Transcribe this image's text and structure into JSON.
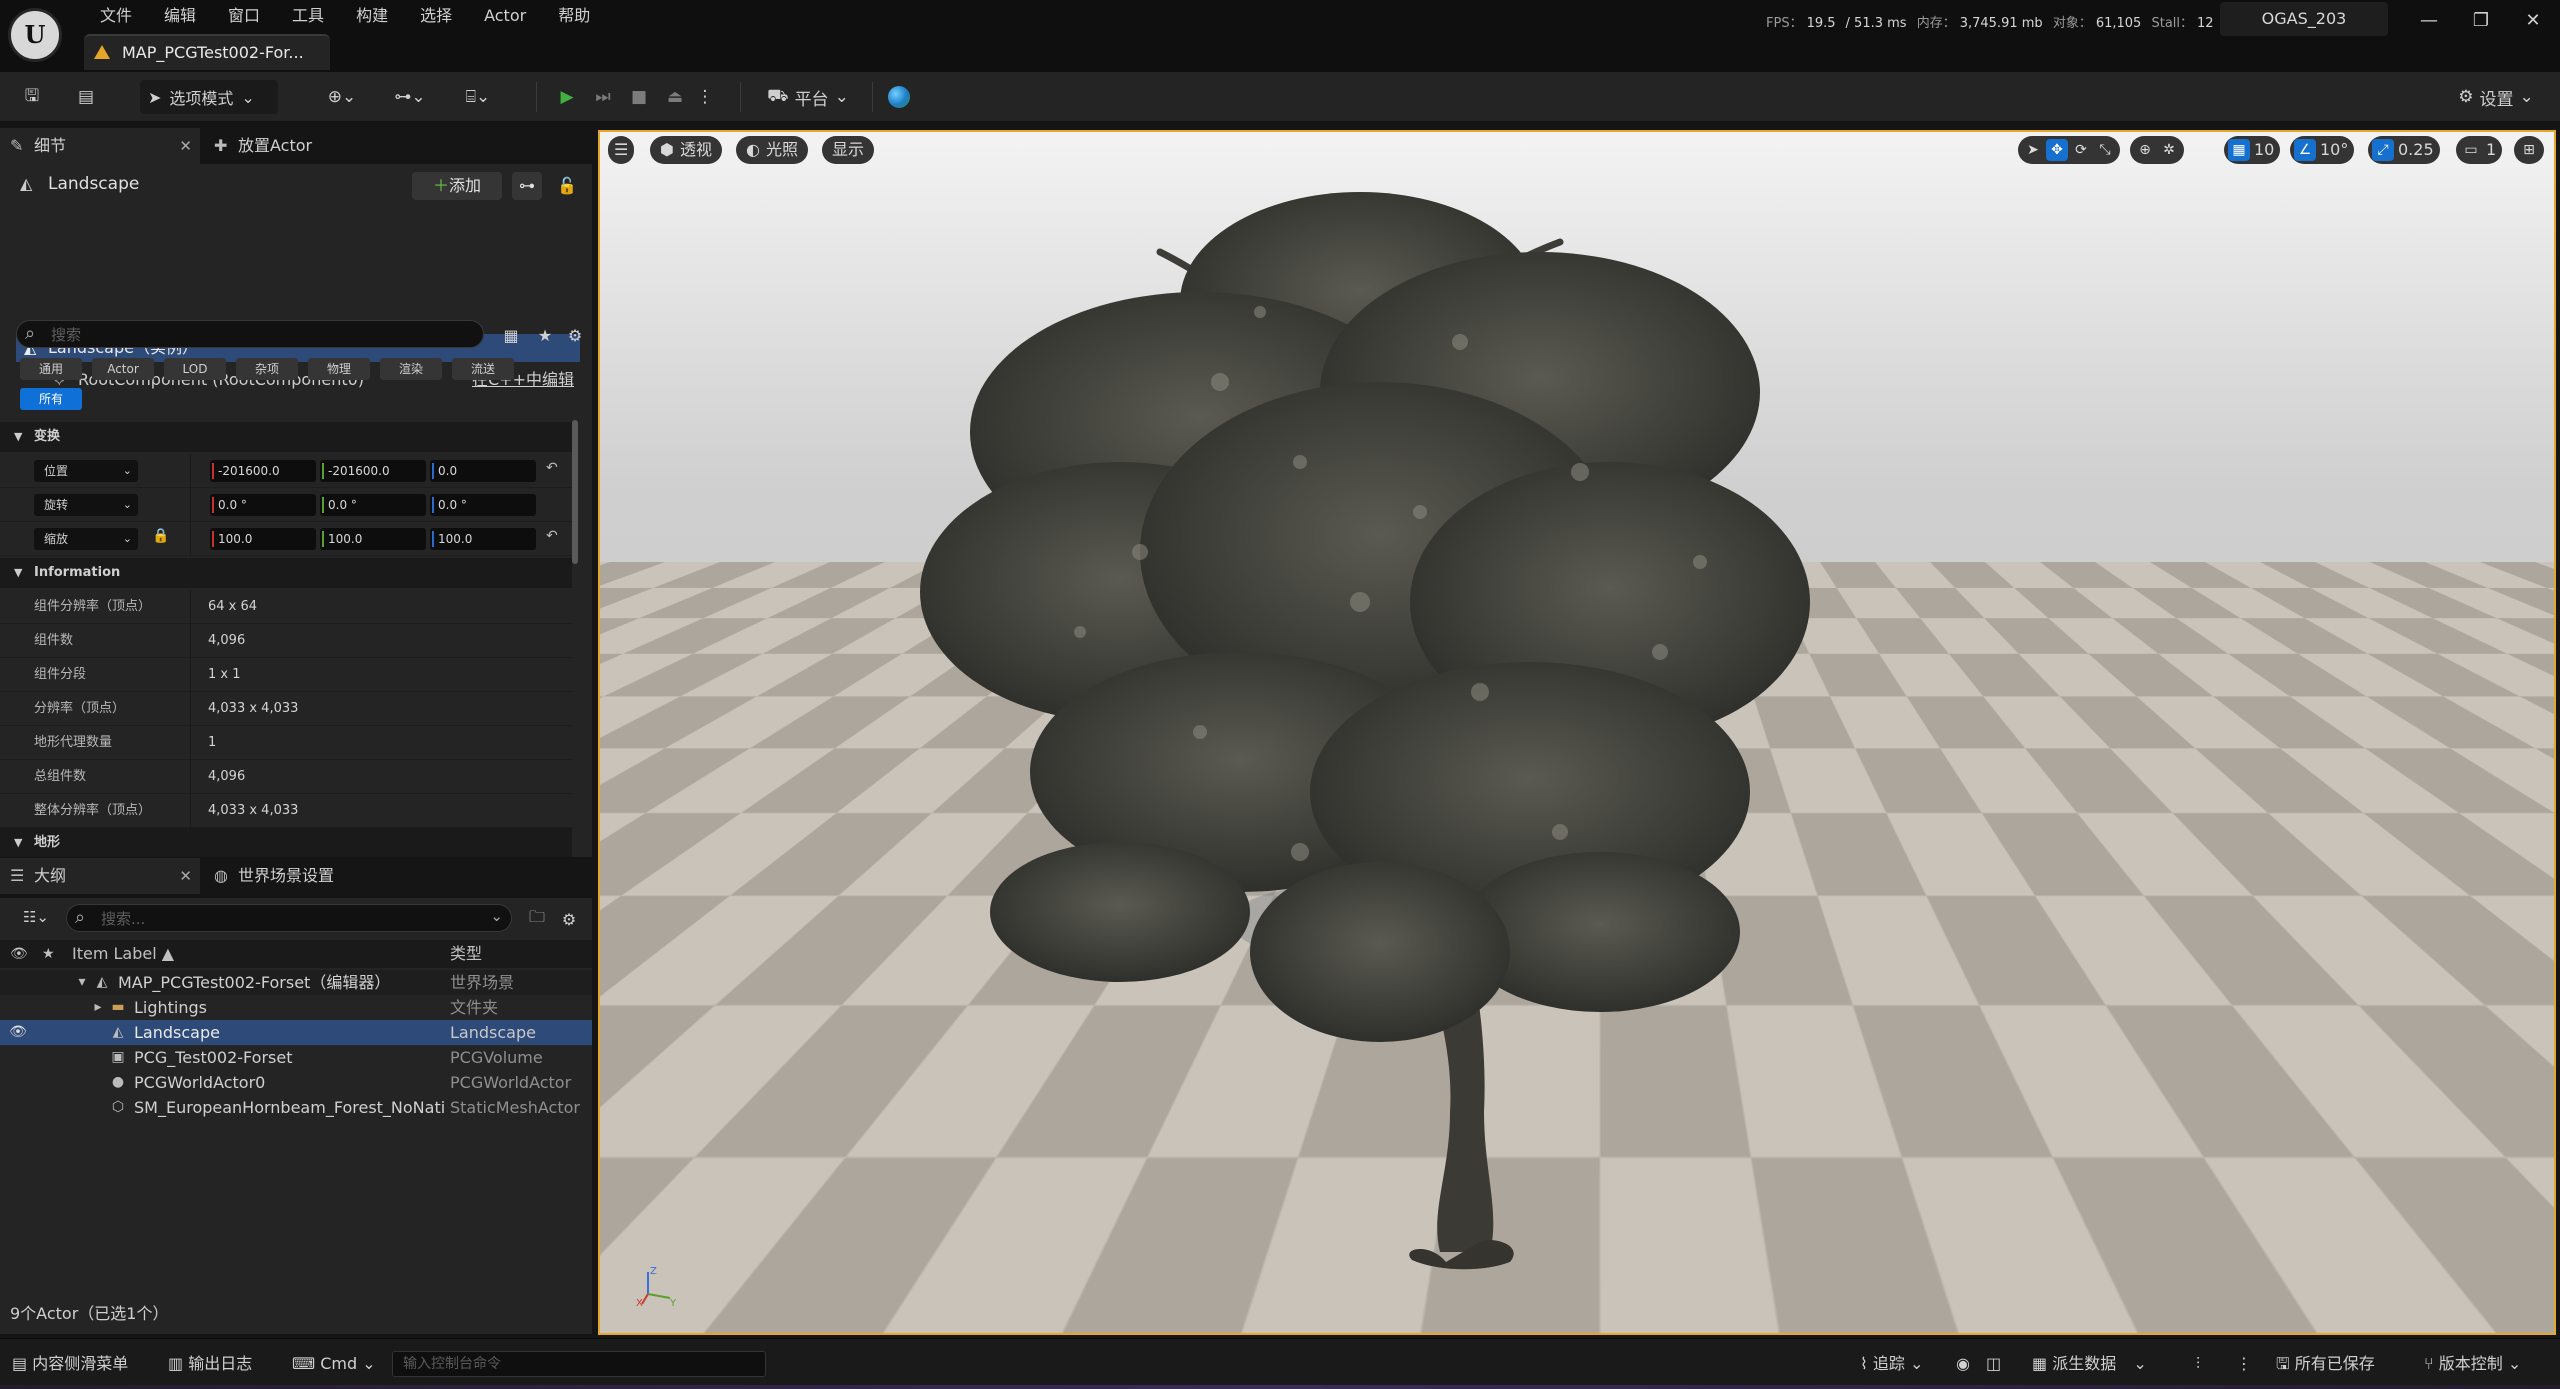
{
  "app": {
    "menu": [
      "文件",
      "编辑",
      "窗口",
      "工具",
      "构建",
      "选择",
      "Actor",
      "帮助"
    ],
    "doc_tab": "MAP_PCGTest002-For...",
    "stats": {
      "fps_label": "FPS：",
      "fps": "19.5",
      "ms": "/ 51.3 ms",
      "mem_label": "内存：",
      "mem": "3,745.91 mb",
      "obj_label": "对象：",
      "obj": "61,105",
      "stall_label": "Stall：",
      "stall": "12"
    },
    "project": "OGAS_203",
    "window_controls": [
      "—",
      "❐",
      "✕"
    ]
  },
  "toolbar": {
    "mode_select": "选项模式",
    "platform": "平台",
    "settings": "设置"
  },
  "details": {
    "tab_details": "细节",
    "tab_place": "放置Actor",
    "actor_name": "Landscape",
    "add_button": "添加",
    "component_root": "Landscape（实例）",
    "component_child": "RootComponent (RootComponent0)",
    "edit_cpp": "在C++中编辑",
    "search_placeholder": "搜索",
    "filters": [
      "通用",
      "Actor",
      "LOD",
      "杂项",
      "物理",
      "渲染",
      "流送"
    ],
    "filter_all": "所有",
    "section_transform": "变换",
    "transform": [
      {
        "label": "位置",
        "x": "-201600.0",
        "y": "-201600.0",
        "z": "0.0"
      },
      {
        "label": "旋转",
        "x": "0.0 °",
        "y": "0.0 °",
        "z": "0.0 °"
      },
      {
        "label": "缩放",
        "x": "100.0",
        "y": "100.0",
        "z": "100.0"
      }
    ],
    "section_info": "Information",
    "info": [
      {
        "label": "组件分辨率（顶点）",
        "value": "64 x 64"
      },
      {
        "label": "组件数",
        "value": "4,096"
      },
      {
        "label": "组件分段",
        "value": "1 x 1"
      },
      {
        "label": "分辨率（顶点）",
        "value": "4,033 x 4,033"
      },
      {
        "label": "地形代理数量",
        "value": "1"
      },
      {
        "label": "总组件数",
        "value": "4,096"
      },
      {
        "label": "整体分辨率（顶点）",
        "value": "4,033 x 4,033"
      }
    ],
    "section_landscape": "地形"
  },
  "outliner": {
    "tab_outliner": "大纲",
    "tab_world": "世界场景设置",
    "search_placeholder": "搜索...",
    "col_label": "Item Label ▲",
    "col_type": "类型",
    "rows": [
      {
        "label": "MAP_PCGTest002-Forset（编辑器）",
        "type": "世界场景"
      },
      {
        "label": "Lightings",
        "type": "文件夹"
      },
      {
        "label": "Landscape",
        "type": "Landscape"
      },
      {
        "label": "PCG_Test002-Forset",
        "type": "PCGVolume"
      },
      {
        "label": "PCGWorldActor0",
        "type": "PCGWorldActor"
      },
      {
        "label": "SM_EuropeanHornbeam_Forest_NoNati",
        "type": "StaticMeshActor"
      }
    ],
    "footer": "9个Actor（已选1个）"
  },
  "viewport": {
    "perspective": "透视",
    "lighting": "光照",
    "show": "显示",
    "grid_snap": "10",
    "rot_snap": "10°",
    "scale_snap": "0.25",
    "camera_speed": "1"
  },
  "statusbar": {
    "content_drawer": "内容侧滑菜单",
    "output_log": "输出日志",
    "cmd": "Cmd",
    "cmd_placeholder": "输入控制台命令",
    "trace": "追踪",
    "derived_data": "派生数据",
    "all_saved": "所有已保存",
    "source_control": "版本控制"
  },
  "colors": {
    "accent_blue": "#0f70d7",
    "selection": "#2d4a78",
    "viewport_border": "#e4a72c",
    "play_green": "#40b040"
  }
}
